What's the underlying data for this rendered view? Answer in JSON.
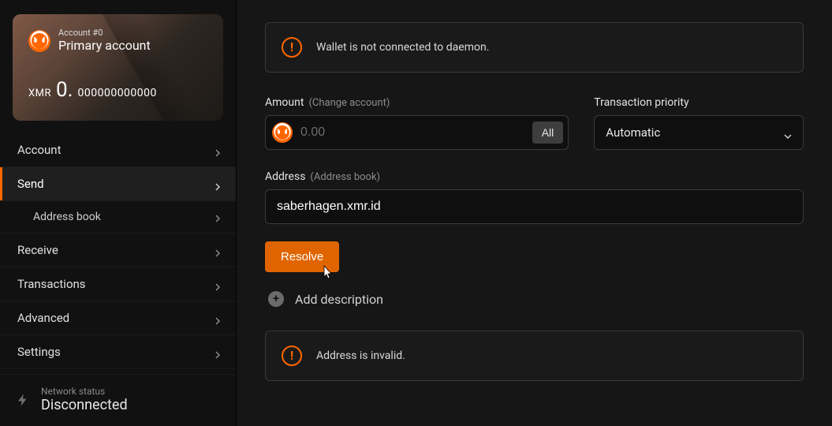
{
  "account": {
    "number_label": "Account #0",
    "name": "Primary account",
    "currency": "XMR",
    "balance_whole": "0.",
    "balance_decimal": "000000000000"
  },
  "nav": {
    "account": "Account",
    "send": "Send",
    "address_book": "Address book",
    "receive": "Receive",
    "transactions": "Transactions",
    "advanced": "Advanced",
    "settings": "Settings"
  },
  "network": {
    "label": "Network status",
    "value": "Disconnected"
  },
  "alerts": {
    "daemon": "Wallet is not connected to daemon.",
    "invalid": "Address is invalid."
  },
  "amount": {
    "label": "Amount",
    "hint": "(Change account)",
    "placeholder": "0.00",
    "value": "",
    "all_label": "All"
  },
  "priority": {
    "label": "Transaction priority",
    "value": "Automatic"
  },
  "address": {
    "label": "Address",
    "hint": "(Address book)",
    "value": "saberhagen.xmr.id"
  },
  "resolve_label": "Resolve",
  "add_description_label": "Add description",
  "colors": {
    "accent": "#ff6600"
  }
}
